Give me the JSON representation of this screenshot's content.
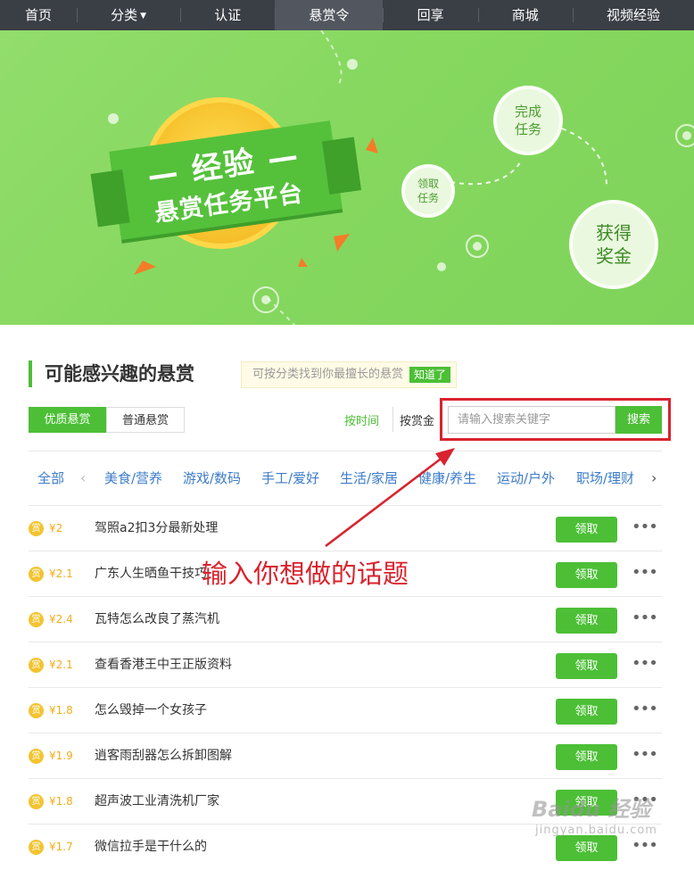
{
  "nav": {
    "items": [
      {
        "label": "首页"
      },
      {
        "label": "分类"
      },
      {
        "label": "认证"
      },
      {
        "label": "悬赏令"
      },
      {
        "label": "回享"
      },
      {
        "label": "商城"
      },
      {
        "label": "视频经验"
      }
    ],
    "active_index": 3
  },
  "banner": {
    "ribbon_title": "— 经验 —",
    "ribbon_subtitle": "悬赏任务平台",
    "step1": "领取\n任务",
    "step2": "完成\n任务",
    "step3": "获得\n奖金"
  },
  "section": {
    "title": "可能感兴趣的悬赏",
    "tip": "可按分类找到你最擅长的悬赏",
    "tip_button": "知道了"
  },
  "filters": {
    "tab_good": "优质悬赏",
    "tab_normal": "普通悬赏",
    "sort_time": "按时间",
    "sort_money": "按赏金",
    "search_placeholder": "请输入搜索关键字",
    "search_button": "搜索"
  },
  "categories": [
    "全部",
    "美食/营养",
    "游戏/数码",
    "手工/爱好",
    "生活/家居",
    "健康/养生",
    "运动/户外",
    "职场/理财"
  ],
  "tasks": [
    {
      "reward": "¥2",
      "title": "驾照a2扣3分最新处理",
      "button": "领取"
    },
    {
      "reward": "¥2.1",
      "title": "广东人生晒鱼干技巧",
      "button": "领取"
    },
    {
      "reward": "¥2.4",
      "title": "瓦特怎么改良了蒸汽机",
      "button": "领取"
    },
    {
      "reward": "¥2.1",
      "title": "查看香港王中王正版资料",
      "button": "领取"
    },
    {
      "reward": "¥1.8",
      "title": "怎么毁掉一个女孩子",
      "button": "领取"
    },
    {
      "reward": "¥1.9",
      "title": "逍客雨刮器怎么拆卸图解",
      "button": "领取"
    },
    {
      "reward": "¥1.8",
      "title": "超声波工业清洗机厂家",
      "button": "领取"
    },
    {
      "reward": "¥1.7",
      "title": "微信拉手是干什么的",
      "button": "领取"
    }
  ],
  "coin_glyph": "赏",
  "more_glyph": "•••",
  "annotation": {
    "text": "输入你想做的话题",
    "color": "#d9232e"
  },
  "watermark": {
    "main": "Baidu 经验",
    "sub": "jingyan.baidu.com"
  },
  "colors": {
    "accent": "#4cbf36",
    "nav_bg": "#3a3e45",
    "reward": "#f0ae1e",
    "category_link": "#3d7cc9"
  }
}
